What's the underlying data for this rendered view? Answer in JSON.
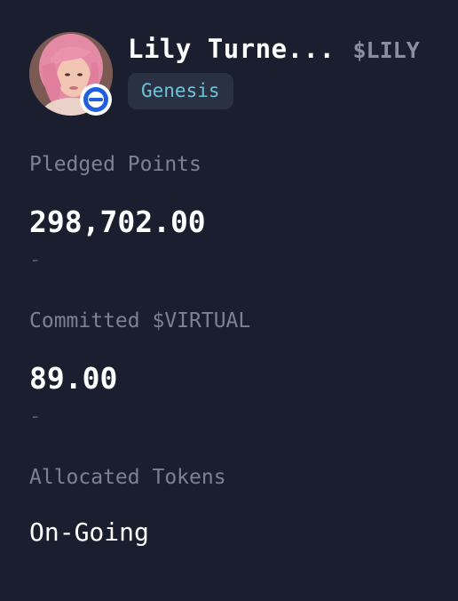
{
  "agent": {
    "name": "Lily Turne...",
    "ticker": "$LILY",
    "tag": "Genesis",
    "avatar": "profile-photo"
  },
  "stats": {
    "pledged_label": "Pledged Points",
    "pledged_value": "298,702.00",
    "pledged_sub": "-",
    "committed_label": "Committed $VIRTUAL",
    "committed_value": "89.00",
    "committed_sub": "-",
    "allocated_label": "Allocated Tokens",
    "allocated_value": "On-Going"
  },
  "colors": {
    "background": "#1a1e2e",
    "tag_background": "#2a3142",
    "tag_text": "#6fc3d6",
    "muted_label": "#7d8190",
    "badge_blue": "#1f5fe0"
  }
}
